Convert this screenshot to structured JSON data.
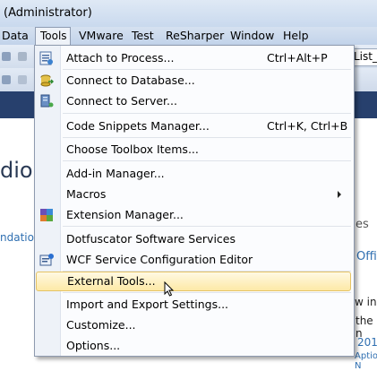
{
  "window": {
    "title": "(Administrator)"
  },
  "menubar": {
    "items": [
      "Data",
      "Tools",
      "VMware",
      "Test",
      "ReSharper",
      "Window",
      "Help"
    ]
  },
  "background": {
    "tab_label": "List_I",
    "heading_fragment": "dio",
    "link_fragment": "ndatior",
    "tab_fragment": "es",
    "office_fragment": "Office",
    "w_in": "w in",
    "the_n": "the n",
    "year": "201",
    "bottom": "Aptio N"
  },
  "tools_menu": {
    "items": [
      {
        "label": "Attach to Process...",
        "shortcut": "Ctrl+Alt+P",
        "icon": "attach-process-icon"
      },
      {
        "label": "Connect to Database...",
        "icon": "connect-database-icon"
      },
      {
        "label": "Connect to Server...",
        "icon": "connect-server-icon"
      },
      {
        "label": "Code Snippets Manager...",
        "shortcut": "Ctrl+K, Ctrl+B"
      },
      {
        "label": "Choose Toolbox Items..."
      },
      {
        "label": "Add-in Manager..."
      },
      {
        "label": "Macros",
        "submenu": true
      },
      {
        "label": "Extension Manager...",
        "icon": "extension-manager-icon"
      },
      {
        "label": "Dotfuscator Software Services"
      },
      {
        "label": "WCF Service Configuration Editor",
        "icon": "wcf-editor-icon"
      },
      {
        "label": "External Tools...",
        "highlighted": true
      },
      {
        "label": "Import and Export Settings..."
      },
      {
        "label": "Customize..."
      },
      {
        "label": "Options..."
      }
    ]
  }
}
